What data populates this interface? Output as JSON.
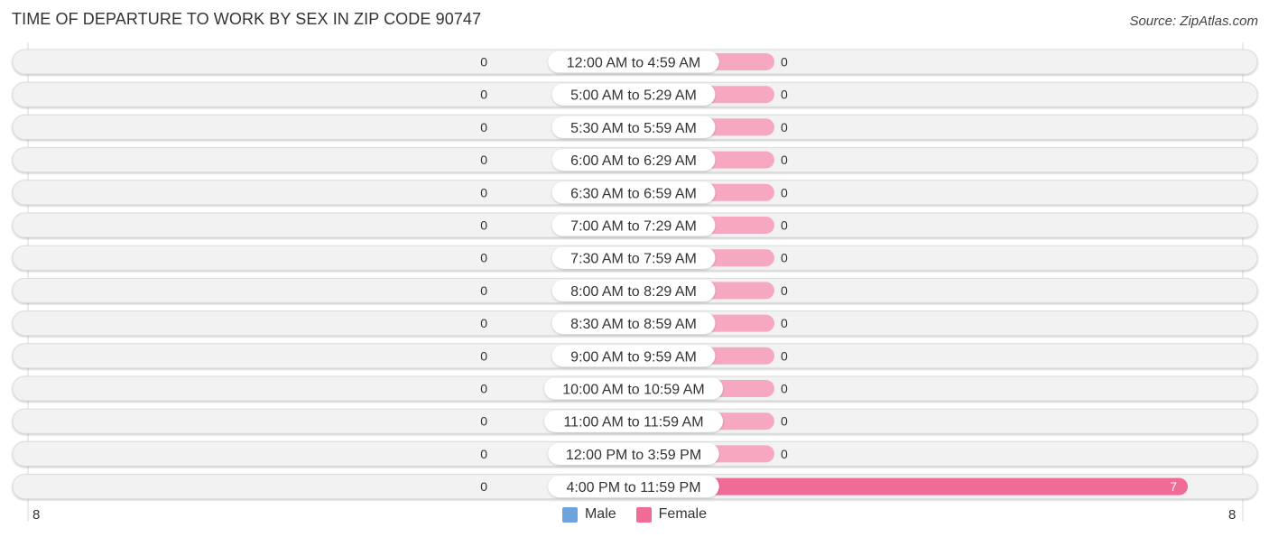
{
  "title": "TIME OF DEPARTURE TO WORK BY SEX IN ZIP CODE 90747",
  "source": "Source: ZipAtlas.com",
  "colors": {
    "male": "#a9c8ec",
    "male_legend": "#6fa3dc",
    "female_light": "#f6a8c0",
    "female": "#f06b96",
    "row_bg": "#f2f2f2"
  },
  "legend": [
    {
      "label": "Male",
      "color": "#6fa3dc"
    },
    {
      "label": "Female",
      "color": "#f06b96"
    }
  ],
  "axis": {
    "left_label": "8",
    "right_label": "8"
  },
  "chart_data": {
    "type": "bar",
    "orientation": "horizontal-butterfly",
    "title": "TIME OF DEPARTURE TO WORK BY SEX IN ZIP CODE 90747",
    "xlabel": "",
    "ylabel": "",
    "xlim": [
      -8,
      8
    ],
    "legend_position": "bottom-center",
    "categories": [
      "12:00 AM to 4:59 AM",
      "5:00 AM to 5:29 AM",
      "5:30 AM to 5:59 AM",
      "6:00 AM to 6:29 AM",
      "6:30 AM to 6:59 AM",
      "7:00 AM to 7:29 AM",
      "7:30 AM to 7:59 AM",
      "8:00 AM to 8:29 AM",
      "8:30 AM to 8:59 AM",
      "9:00 AM to 9:59 AM",
      "10:00 AM to 10:59 AM",
      "11:00 AM to 11:59 AM",
      "12:00 PM to 3:59 PM",
      "4:00 PM to 11:59 PM"
    ],
    "series": [
      {
        "name": "Male",
        "values": [
          0,
          0,
          0,
          0,
          0,
          0,
          0,
          0,
          0,
          0,
          0,
          0,
          0,
          0
        ]
      },
      {
        "name": "Female",
        "values": [
          0,
          0,
          0,
          0,
          0,
          0,
          0,
          0,
          0,
          0,
          0,
          0,
          0,
          7
        ]
      }
    ]
  }
}
